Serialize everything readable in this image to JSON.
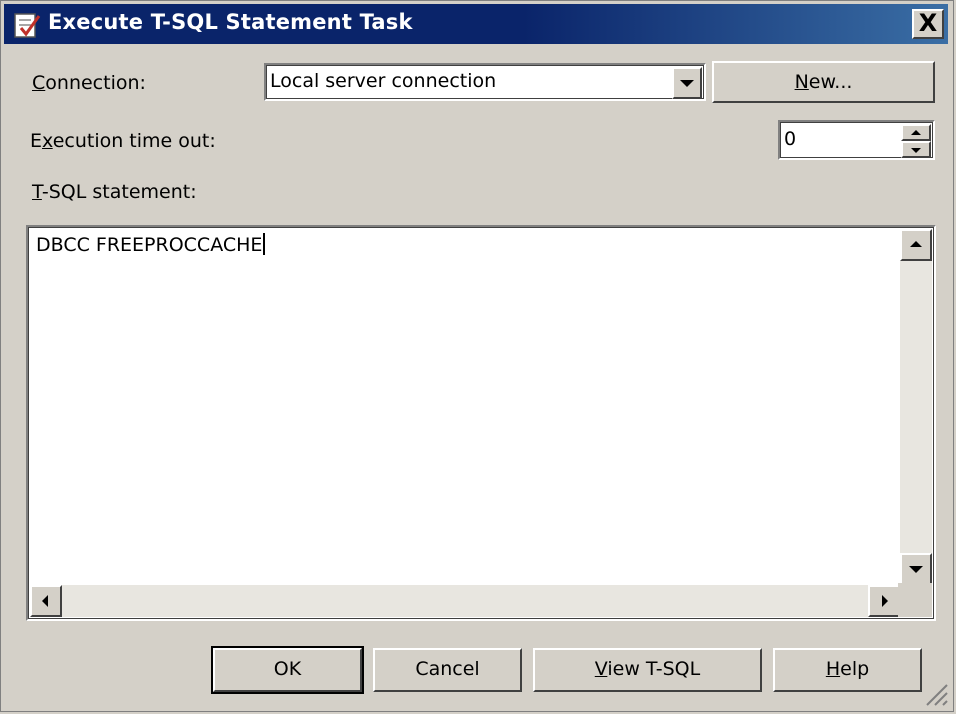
{
  "window": {
    "title": "Execute T-SQL Statement Task",
    "close_label": "X"
  },
  "connection": {
    "label_prefix": "",
    "label_mnemonic": "C",
    "label_rest": "onnection:",
    "value": "Local server connection",
    "new_button_mnemonic": "N",
    "new_button_rest": "ew..."
  },
  "timeout": {
    "label_prefix": "E",
    "label_mnemonic": "x",
    "label_rest": "ecution time out:",
    "value": "0"
  },
  "statement": {
    "label_mnemonic": "T",
    "label_rest": "-SQL statement:",
    "text": "DBCC FREEPROCCACHE"
  },
  "buttons": {
    "ok": "OK",
    "cancel": "Cancel",
    "view_mnemonic": "V",
    "view_rest": "iew T-SQL",
    "help_mnemonic": "H",
    "help_rest": "elp"
  }
}
